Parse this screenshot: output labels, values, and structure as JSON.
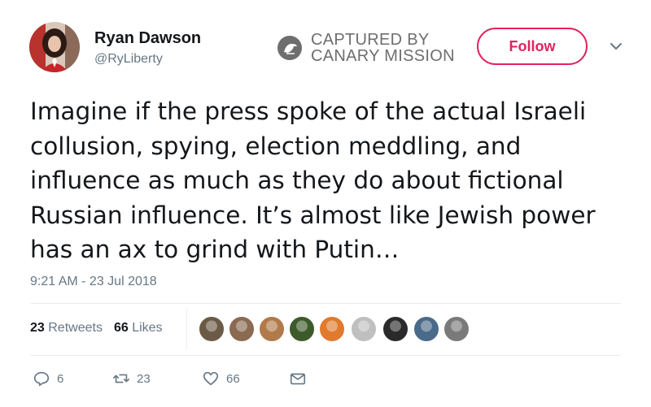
{
  "author": {
    "display_name": "Ryan Dawson",
    "handle": "@RyLiberty",
    "avatar_icon": "profile-photo"
  },
  "watermark": {
    "line1": "CAPTURED BY",
    "line2": "CANARY MISSION",
    "icon": "canary-bird-logo"
  },
  "follow_button": {
    "label": "Follow",
    "color": "#e0245e"
  },
  "tweet": {
    "text": "Imagine if the press spoke of the actual Israeli collusion, spying, election meddling, and influence as much as they do about fictional Russian influence.  It’s almost like Jewish power has an ax to grind with Putin…",
    "timestamp": "9:21 AM - 23 Jul 2018"
  },
  "stats": {
    "retweets_count": "23",
    "retweets_label": "Retweets",
    "likes_count": "66",
    "likes_label": "Likes"
  },
  "likers": [
    {
      "icon": "liker-avatar-1",
      "color": "#6b5a45"
    },
    {
      "icon": "liker-avatar-2",
      "color": "#8a6a52"
    },
    {
      "icon": "liker-avatar-3",
      "color": "#b07a4a"
    },
    {
      "icon": "liker-avatar-4",
      "color": "#3d5a2a"
    },
    {
      "icon": "liker-avatar-5",
      "color": "#e07a2e"
    },
    {
      "icon": "liker-avatar-6",
      "color": "#bfbfbf"
    },
    {
      "icon": "liker-avatar-7",
      "color": "#2a2a2a"
    },
    {
      "icon": "liker-avatar-8",
      "color": "#4a6a8a"
    },
    {
      "icon": "liker-avatar-9",
      "color": "#7a7a7a"
    }
  ],
  "actions": {
    "reply_count": "6",
    "retweet_count": "23",
    "like_count": "66"
  },
  "colors": {
    "text": "#14171a",
    "secondary": "#657786",
    "divider": "#e6ecf0"
  }
}
